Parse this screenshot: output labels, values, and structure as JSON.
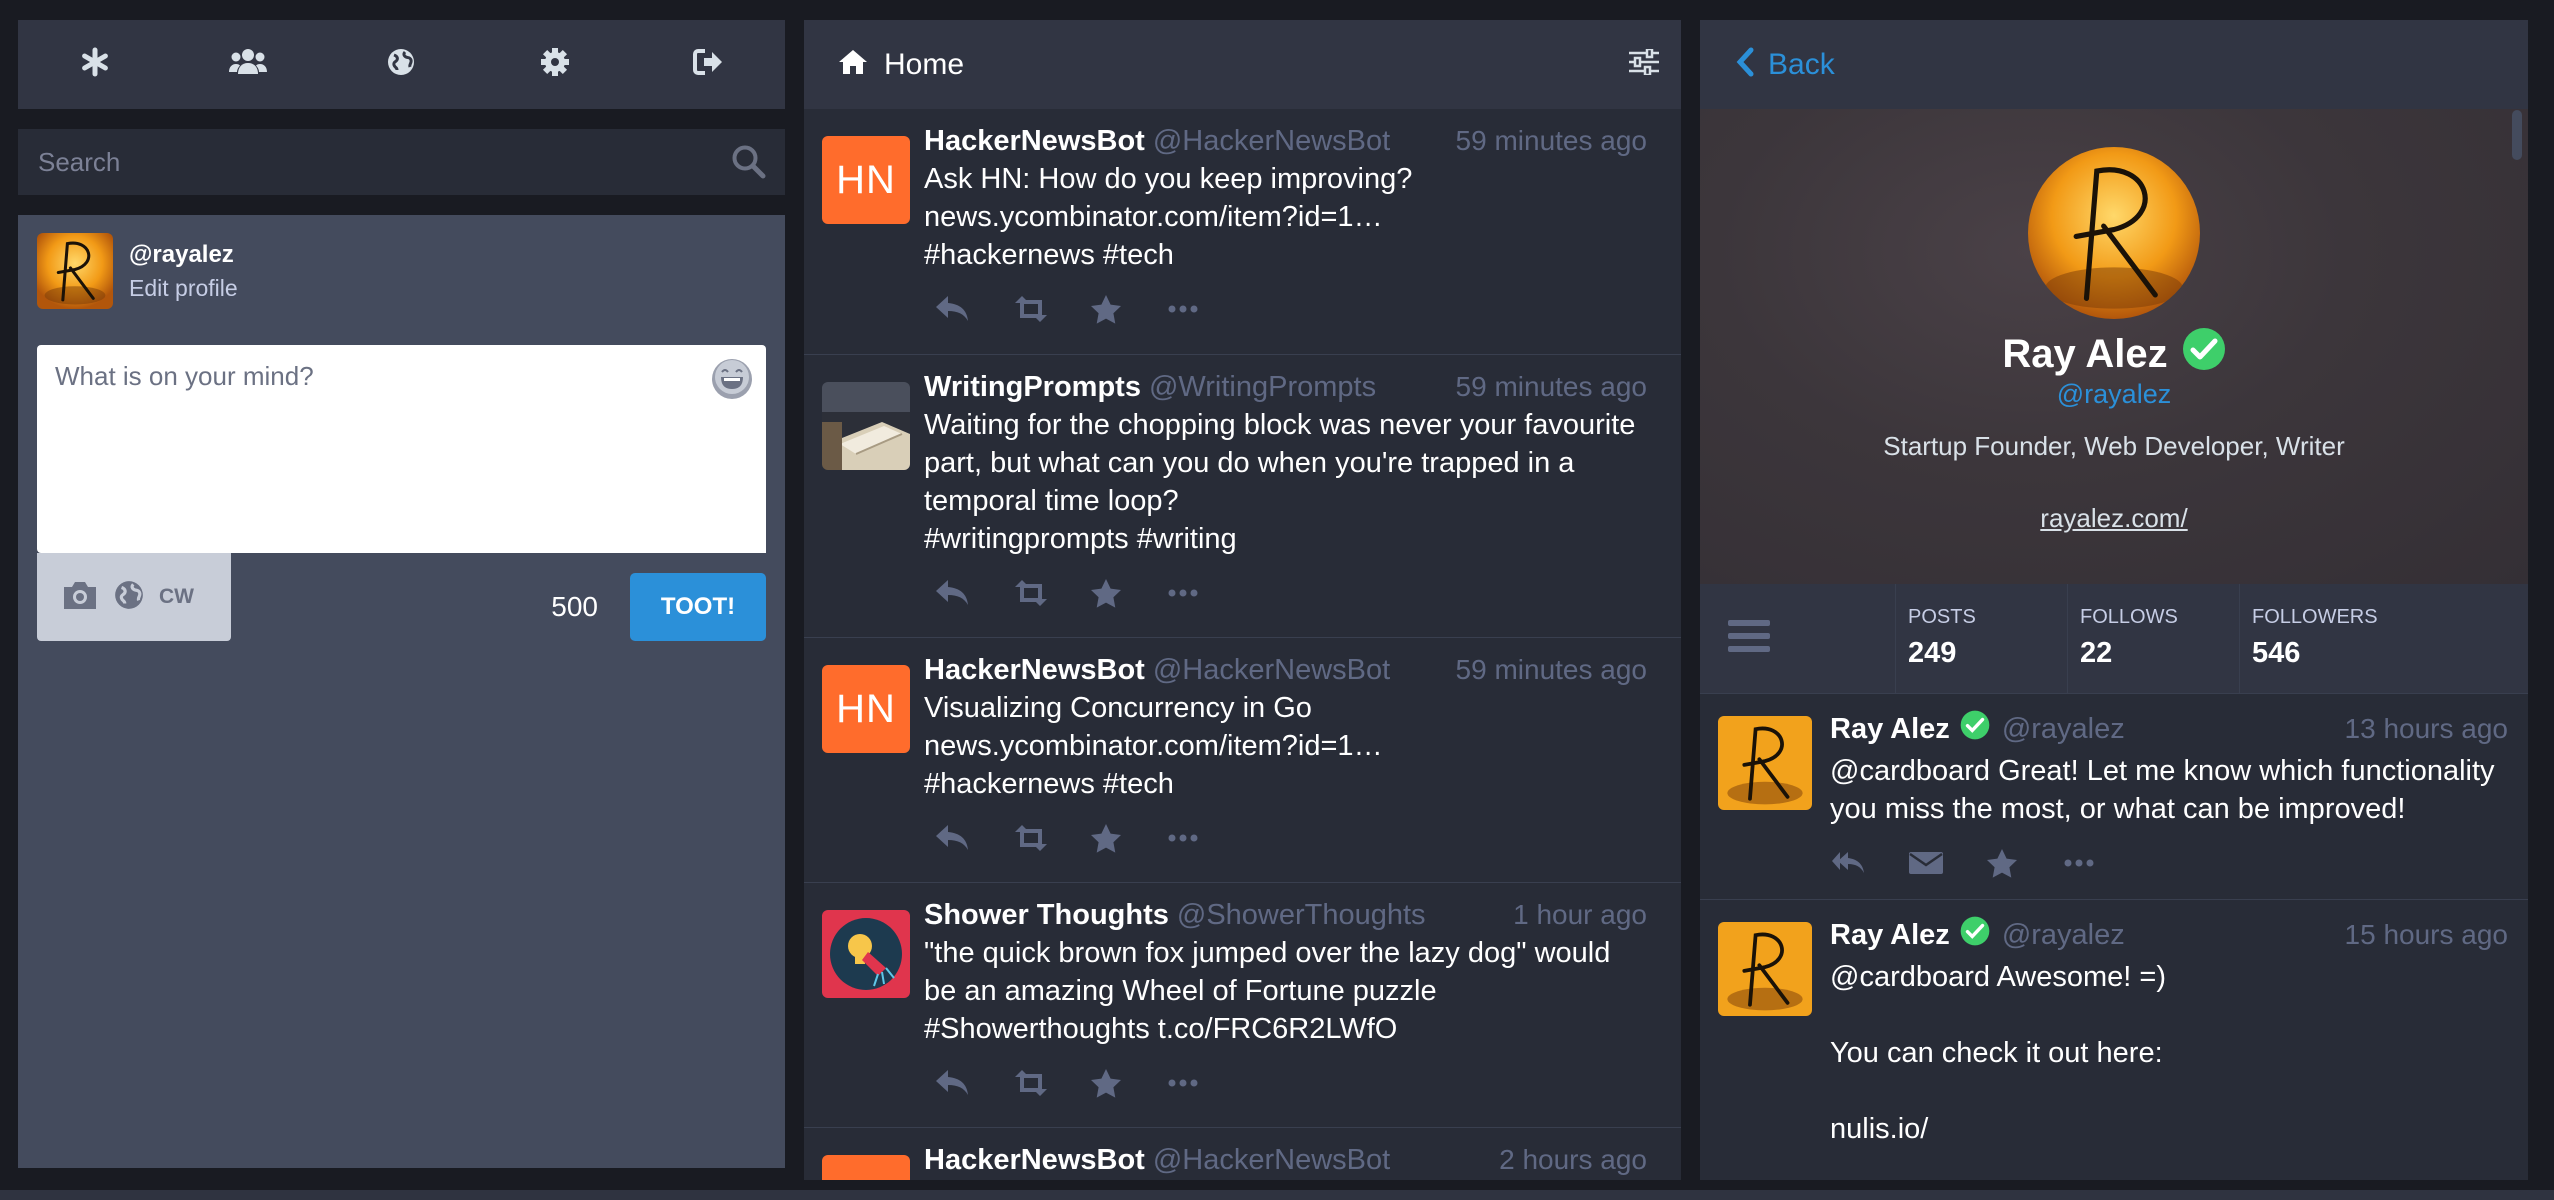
{
  "nav": {
    "items": [
      {
        "name": "getting-started",
        "icon": "asterisk-icon"
      },
      {
        "name": "local-timeline",
        "icon": "users-icon"
      },
      {
        "name": "federated-timeline",
        "icon": "globe-icon"
      },
      {
        "name": "preferences",
        "icon": "gear-icon"
      },
      {
        "name": "logout",
        "icon": "sign-out-icon"
      }
    ]
  },
  "search": {
    "placeholder": "Search"
  },
  "me": {
    "handle": "@rayalez",
    "edit_label": "Edit profile"
  },
  "compose": {
    "placeholder": "What is on your mind?",
    "cw_label": "CW",
    "counter": "500",
    "submit_label": "TOOT!"
  },
  "home": {
    "title": "Home",
    "statuses": [
      {
        "name": "HackerNewsBot",
        "acct": "@HackerNewsBot",
        "time": "59 minutes ago",
        "avatar": "HN",
        "lines": [
          "Ask HN: How do you keep improving?",
          "news.ycombinator.com/item?id=1…",
          "#hackernews #tech"
        ]
      },
      {
        "name": "WritingPrompts",
        "acct": "@WritingPrompts",
        "time": "59 minutes ago",
        "avatar": "book-photo",
        "lines": [
          "Waiting for the chopping block was never your favourite",
          "part, but what can you do when you're trapped in a",
          "temporal time loop?",
          "#writingprompts #writing"
        ]
      },
      {
        "name": "HackerNewsBot",
        "acct": "@HackerNewsBot",
        "time": "59 minutes ago",
        "avatar": "HN",
        "lines": [
          "Visualizing Concurrency in Go",
          "news.ycombinator.com/item?id=1…",
          "#hackernews #tech"
        ]
      },
      {
        "name": "Shower Thoughts",
        "acct": "@ShowerThoughts",
        "time": "1 hour ago",
        "avatar": "lightbulb-shower",
        "lines": [
          "\"the quick brown fox jumped over the lazy dog\" would",
          "be an amazing Wheel of Fortune puzzle",
          "#Showerthoughts t.co/FRC6R2LWfO"
        ]
      },
      {
        "name": "HackerNewsBot",
        "acct": "@HackerNewsBot",
        "time": "2 hours ago",
        "avatar": "HN",
        "lines": []
      }
    ]
  },
  "profile": {
    "back_label": "Back",
    "display_name": "Ray Alez",
    "acct": "@rayalez",
    "bio": "Startup Founder, Web Developer, Writer",
    "link": "rayalez.com/",
    "counters": [
      {
        "label": "POSTS",
        "value": "249"
      },
      {
        "label": "FOLLOWS",
        "value": "22"
      },
      {
        "label": "FOLLOWERS",
        "value": "546"
      }
    ],
    "statuses": [
      {
        "name": "Ray Alez",
        "acct": "@rayalez",
        "time": "13 hours ago",
        "lines": [
          "@cardboard Great! Let me know which functionality",
          "you miss the most, or what can be improved!"
        ]
      },
      {
        "name": "Ray Alez",
        "acct": "@rayalez",
        "time": "15 hours ago",
        "lines": [
          "@cardboard Awesome! =)",
          "",
          "You can check it out here:",
          "",
          "nulis.io/"
        ]
      }
    ]
  },
  "colors": {
    "accent": "#2b90d9",
    "verified": "#3ecf6a",
    "hn": "#ff6c2c"
  }
}
